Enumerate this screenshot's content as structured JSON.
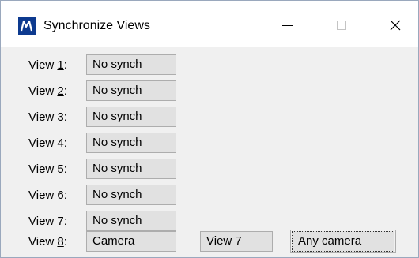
{
  "window": {
    "title": "Synchronize Views",
    "controls": {
      "minimize_icon": "minimize-icon",
      "maximize_icon": "maximize-icon",
      "close_icon": "close-icon"
    },
    "app_icon": "microstation-icon",
    "accent_color": "#0d3a8f"
  },
  "views": [
    {
      "label_prefix": "View ",
      "label_key": "1",
      "label_suffix": ":",
      "mode": "No synch"
    },
    {
      "label_prefix": "View ",
      "label_key": "2",
      "label_suffix": ":",
      "mode": "No synch"
    },
    {
      "label_prefix": "View ",
      "label_key": "3",
      "label_suffix": ":",
      "mode": "No synch"
    },
    {
      "label_prefix": "View ",
      "label_key": "4",
      "label_suffix": ":",
      "mode": "No synch"
    },
    {
      "label_prefix": "View ",
      "label_key": "5",
      "label_suffix": ":",
      "mode": "No synch"
    },
    {
      "label_prefix": "View ",
      "label_key": "6",
      "label_suffix": ":",
      "mode": "No synch"
    },
    {
      "label_prefix": "View ",
      "label_key": "7",
      "label_suffix": ":",
      "mode": "No synch"
    },
    {
      "label_prefix": "View ",
      "label_key": "8",
      "label_suffix": ":",
      "mode": "Camera",
      "source_view": "View 7",
      "camera_option": "Any camera"
    }
  ]
}
